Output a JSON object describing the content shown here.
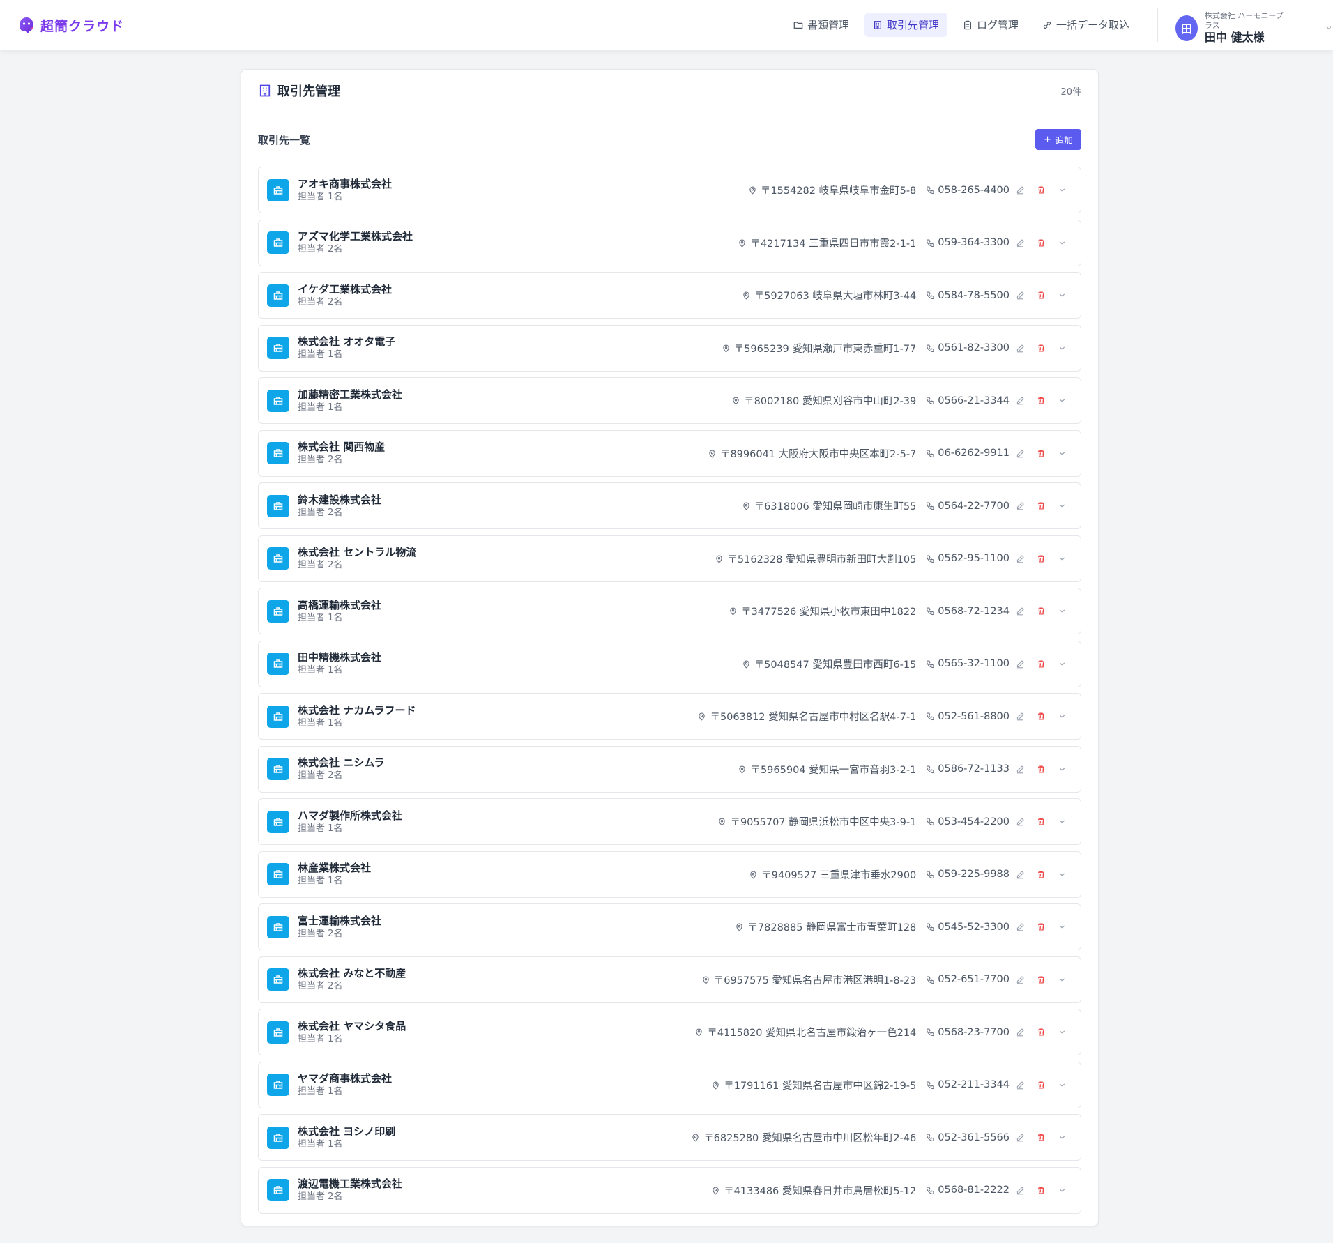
{
  "app": {
    "name": "超簡クラウド",
    "brand_color": "#7c3aed"
  },
  "nav": [
    {
      "label": "書類管理",
      "icon": "folder-icon",
      "active": false
    },
    {
      "label": "取引先管理",
      "icon": "building-icon",
      "active": true
    },
    {
      "label": "ログ管理",
      "icon": "clipboard-icon",
      "active": false
    },
    {
      "label": "一括データ取込",
      "icon": "link-icon",
      "active": false
    }
  ],
  "user": {
    "initial": "田",
    "company": "株式会社 ハーモニープラス",
    "name": "田中 健太様"
  },
  "page": {
    "title": "取引先管理",
    "count": "20件",
    "list_title": "取引先一覧",
    "add_label": "追加"
  },
  "clients": [
    {
      "name": "アオキ商事株式会社",
      "staff": "担当者 1名",
      "address": "〒1554282 岐阜県岐阜市金町5-8",
      "phone": "058-265-4400"
    },
    {
      "name": "アズマ化学工業株式会社",
      "staff": "担当者 2名",
      "address": "〒4217134 三重県四日市市霞2-1-1",
      "phone": "059-364-3300"
    },
    {
      "name": "イケダ工業株式会社",
      "staff": "担当者 2名",
      "address": "〒5927063 岐阜県大垣市林町3-44",
      "phone": "0584-78-5500"
    },
    {
      "name": "株式会社 オオタ電子",
      "staff": "担当者 1名",
      "address": "〒5965239 愛知県瀬戸市東赤重町1-77",
      "phone": "0561-82-3300"
    },
    {
      "name": "加藤精密工業株式会社",
      "staff": "担当者 1名",
      "address": "〒8002180 愛知県刈谷市中山町2-39",
      "phone": "0566-21-3344"
    },
    {
      "name": "株式会社 関西物産",
      "staff": "担当者 2名",
      "address": "〒8996041 大阪府大阪市中央区本町2-5-7",
      "phone": "06-6262-9911"
    },
    {
      "name": "鈴木建設株式会社",
      "staff": "担当者 2名",
      "address": "〒6318006 愛知県岡崎市康生町55",
      "phone": "0564-22-7700"
    },
    {
      "name": "株式会社 セントラル物流",
      "staff": "担当者 2名",
      "address": "〒5162328 愛知県豊明市新田町大割105",
      "phone": "0562-95-1100"
    },
    {
      "name": "高橋運輸株式会社",
      "staff": "担当者 1名",
      "address": "〒3477526 愛知県小牧市東田中1822",
      "phone": "0568-72-1234"
    },
    {
      "name": "田中精機株式会社",
      "staff": "担当者 1名",
      "address": "〒5048547 愛知県豊田市西町6-15",
      "phone": "0565-32-1100"
    },
    {
      "name": "株式会社 ナカムラフード",
      "staff": "担当者 1名",
      "address": "〒5063812 愛知県名古屋市中村区名駅4-7-1",
      "phone": "052-561-8800"
    },
    {
      "name": "株式会社 ニシムラ",
      "staff": "担当者 2名",
      "address": "〒5965904 愛知県一宮市音羽3-2-1",
      "phone": "0586-72-1133"
    },
    {
      "name": "ハマダ製作所株式会社",
      "staff": "担当者 1名",
      "address": "〒9055707 静岡県浜松市中区中央3-9-1",
      "phone": "053-454-2200"
    },
    {
      "name": "林産業株式会社",
      "staff": "担当者 1名",
      "address": "〒9409527 三重県津市垂水2900",
      "phone": "059-225-9988"
    },
    {
      "name": "富士運輸株式会社",
      "staff": "担当者 2名",
      "address": "〒7828885 静岡県富士市青葉町128",
      "phone": "0545-52-3300"
    },
    {
      "name": "株式会社 みなと不動産",
      "staff": "担当者 2名",
      "address": "〒6957575 愛知県名古屋市港区港明1-8-23",
      "phone": "052-651-7700"
    },
    {
      "name": "株式会社 ヤマシタ食品",
      "staff": "担当者 1名",
      "address": "〒4115820 愛知県北名古屋市鍛治ヶ一色214",
      "phone": "0568-23-7700"
    },
    {
      "name": "ヤマダ商事株式会社",
      "staff": "担当者 1名",
      "address": "〒1791161 愛知県名古屋市中区錦2-19-5",
      "phone": "052-211-3344"
    },
    {
      "name": "株式会社 ヨシノ印刷",
      "staff": "担当者 1名",
      "address": "〒6825280 愛知県名古屋市中川区松年町2-46",
      "phone": "052-361-5566"
    },
    {
      "name": "渡辺電機工業株式会社",
      "staff": "担当者 2名",
      "address": "〒4133486 愛知県春日井市鳥居松町5-12",
      "phone": "0568-81-2222"
    }
  ],
  "colors": {
    "accent": "#5b5bf0",
    "row_icon": "#0ea5e9",
    "delete": "#ef4444"
  }
}
